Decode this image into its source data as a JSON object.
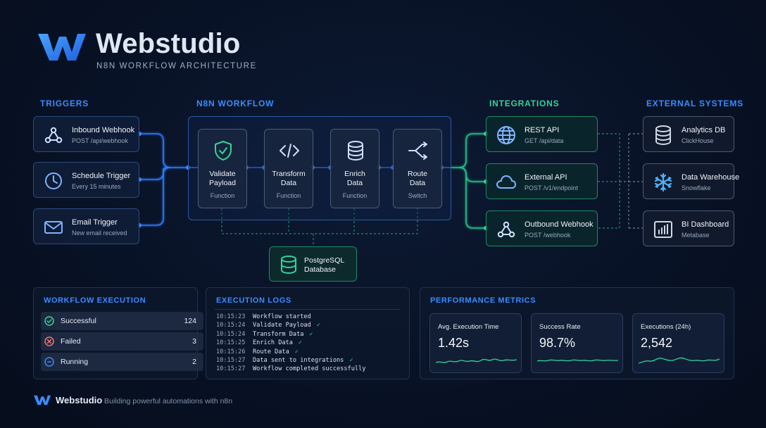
{
  "brand": {
    "name": "Webstudio",
    "subtitle": "N8N WORKFLOW ARCHITECTURE"
  },
  "sections": {
    "triggers": "TRIGGERS",
    "workflow": "N8N WORKFLOW",
    "integrations": "INTEGRATIONS",
    "external": "EXTERNAL SYSTEMS"
  },
  "triggers": [
    {
      "title": "Inbound Webhook",
      "sub": "POST /api/webhook",
      "icon": "webhook-icon"
    },
    {
      "title": "Schedule Trigger",
      "sub": "Every 15 minutes",
      "icon": "clock-icon"
    },
    {
      "title": "Email Trigger",
      "sub": "New email received",
      "icon": "mail-icon"
    }
  ],
  "nodes": [
    {
      "title": "Validate Payload",
      "type": "Function",
      "icon": "shield-check-icon"
    },
    {
      "title": "Transform Data",
      "type": "Function",
      "icon": "code-icon"
    },
    {
      "title": "Enrich Data",
      "type": "Function",
      "icon": "database-icon"
    },
    {
      "title": "Route Data",
      "type": "Switch",
      "icon": "split-arrows-icon"
    }
  ],
  "database": {
    "title": "PostgreSQL Database"
  },
  "integrations": [
    {
      "title": "REST API",
      "sub": "GET /api/data",
      "icon": "globe-icon"
    },
    {
      "title": "External API",
      "sub": "POST /v1/endpoint",
      "icon": "cloud-icon"
    },
    {
      "title": "Outbound Webhook",
      "sub": "POST /webhook",
      "icon": "webhook-icon"
    }
  ],
  "external": [
    {
      "title": "Analytics DB",
      "sub": "ClickHouse",
      "icon": "database-icon"
    },
    {
      "title": "Data Warehouse",
      "sub": "Snowflake",
      "icon": "snowflake-icon"
    },
    {
      "title": "BI Dashboard",
      "sub": "Metabase",
      "icon": "bar-chart-icon"
    }
  ],
  "execution": {
    "title": "WORKFLOW EXECUTION",
    "rows": [
      {
        "label": "Successful",
        "value": "124",
        "color": "#34d399"
      },
      {
        "label": "Failed",
        "value": "3",
        "color": "#f87171"
      },
      {
        "label": "Running",
        "value": "2",
        "color": "#3b8cff"
      }
    ]
  },
  "logs": {
    "title": "EXECUTION LOGS",
    "lines": [
      {
        "time": "10:15:23",
        "msg": "Workflow started",
        "ok": ""
      },
      {
        "time": "10:15:24",
        "msg": "Validate Payload",
        "ok": "✓"
      },
      {
        "time": "10:15:24",
        "msg": "Transform Data",
        "ok": "✓"
      },
      {
        "time": "10:15:25",
        "msg": "Enrich Data",
        "ok": "✓"
      },
      {
        "time": "10:15:26",
        "msg": "Route Data",
        "ok": "✓"
      },
      {
        "time": "10:15:27",
        "msg": "Data sent to integrations",
        "ok": "✓"
      },
      {
        "time": "10:15:27",
        "msg": "Workflow completed successfully",
        "ok": ""
      }
    ]
  },
  "metrics": {
    "title": "PERFORMANCE METRICS",
    "items": [
      {
        "label": "Avg. Execution Time",
        "value": "1.42s"
      },
      {
        "label": "Success Rate",
        "value": "98.7%"
      },
      {
        "label": "Executions (24h)",
        "value": "2,542"
      }
    ]
  },
  "footer": {
    "name": "Webstudio",
    "tagline": "Building powerful automations with n8n"
  },
  "colors": {
    "blue": "#3b8cff",
    "green": "#34d399",
    "red": "#f87171",
    "background": "#081226"
  }
}
